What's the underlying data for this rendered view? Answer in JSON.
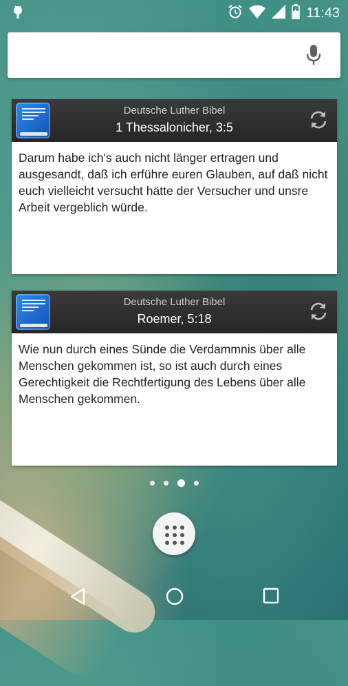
{
  "status_bar": {
    "time": "11:43",
    "icons": [
      "android-icon",
      "alarm-icon",
      "wifi-icon",
      "signal-icon",
      "battery-icon"
    ]
  },
  "search_bar": {
    "placeholder": "",
    "icons": [
      "mic-icon"
    ]
  },
  "widgets": [
    {
      "source": "Deutsche Luther Bibel",
      "reference": "1 Thessalonicher, 3:5",
      "verse": "Darum habe ich's auch nicht länger ertragen und ausgesandt, daß ich erführe euren Glauben, auf daß nicht euch vielleicht versucht hätte der Versucher und unsre Arbeit vergeblich würde."
    },
    {
      "source": "Deutsche Luther Bibel",
      "reference": "Roemer, 5:18",
      "verse": "Wie nun durch eines Sünde die Verdammnis über alle Menschen gekommen ist, so ist auch durch eines Gerechtigkeit die Rechtfertigung des Lebens über alle Menschen gekommen."
    }
  ],
  "page_indicator": {
    "pages": 4,
    "current": 3
  },
  "navigation": [
    "back-icon",
    "home-icon",
    "recents-icon"
  ],
  "colors": {
    "widget_header": "#2e2e2e",
    "book_icon": "#1f6fd6",
    "status_text": "#ffffff"
  }
}
